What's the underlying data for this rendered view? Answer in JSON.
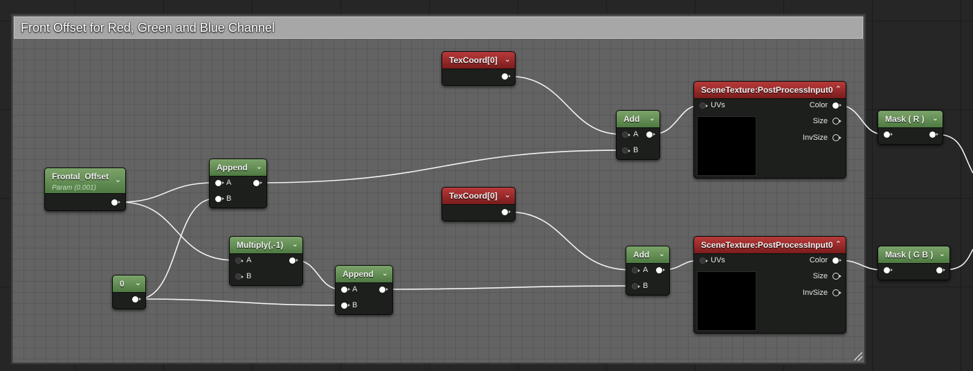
{
  "comment": {
    "title": "Front Offset for Red, Green and Blue Channel"
  },
  "nodes": {
    "texcoord_top": {
      "title": "TexCoord[0]"
    },
    "texcoord_bottom": {
      "title": "TexCoord[0]"
    },
    "frontal_offset": {
      "title": "Frontal_Offset",
      "subtitle": "Param (0.001)"
    },
    "constant_zero": {
      "title": "0"
    },
    "append_top": {
      "title": "Append",
      "in_a": "A",
      "in_b": "B"
    },
    "multiply": {
      "title": "Multiply(,-1)",
      "in_a": "A",
      "in_b": "B"
    },
    "append_bottom": {
      "title": "Append",
      "in_a": "A",
      "in_b": "B"
    },
    "add_top": {
      "title": "Add",
      "in_a": "A",
      "in_b": "B"
    },
    "add_bottom": {
      "title": "Add",
      "in_a": "A",
      "in_b": "B"
    },
    "scene_texture_top": {
      "title": "SceneTexture:PostProcessInput0",
      "in_uvs": "UVs",
      "out_color": "Color",
      "out_size": "Size",
      "out_invsize": "InvSize"
    },
    "scene_texture_bottom": {
      "title": "SceneTexture:PostProcessInput0",
      "in_uvs": "UVs",
      "out_color": "Color",
      "out_size": "Size",
      "out_invsize": "InvSize"
    },
    "mask_r": {
      "title": "Mask ( R )"
    },
    "mask_gb": {
      "title": "Mask ( G B )"
    }
  },
  "colors": {
    "node_green": "#5e8a50",
    "node_red": "#9a2a2a",
    "wire": "#ffffff",
    "comment_header": "#a7a7a7"
  },
  "icons": {
    "expand": "chevron-down-icon",
    "collapse": "chevron-up-icon",
    "resize": "resize-grip-icon"
  }
}
